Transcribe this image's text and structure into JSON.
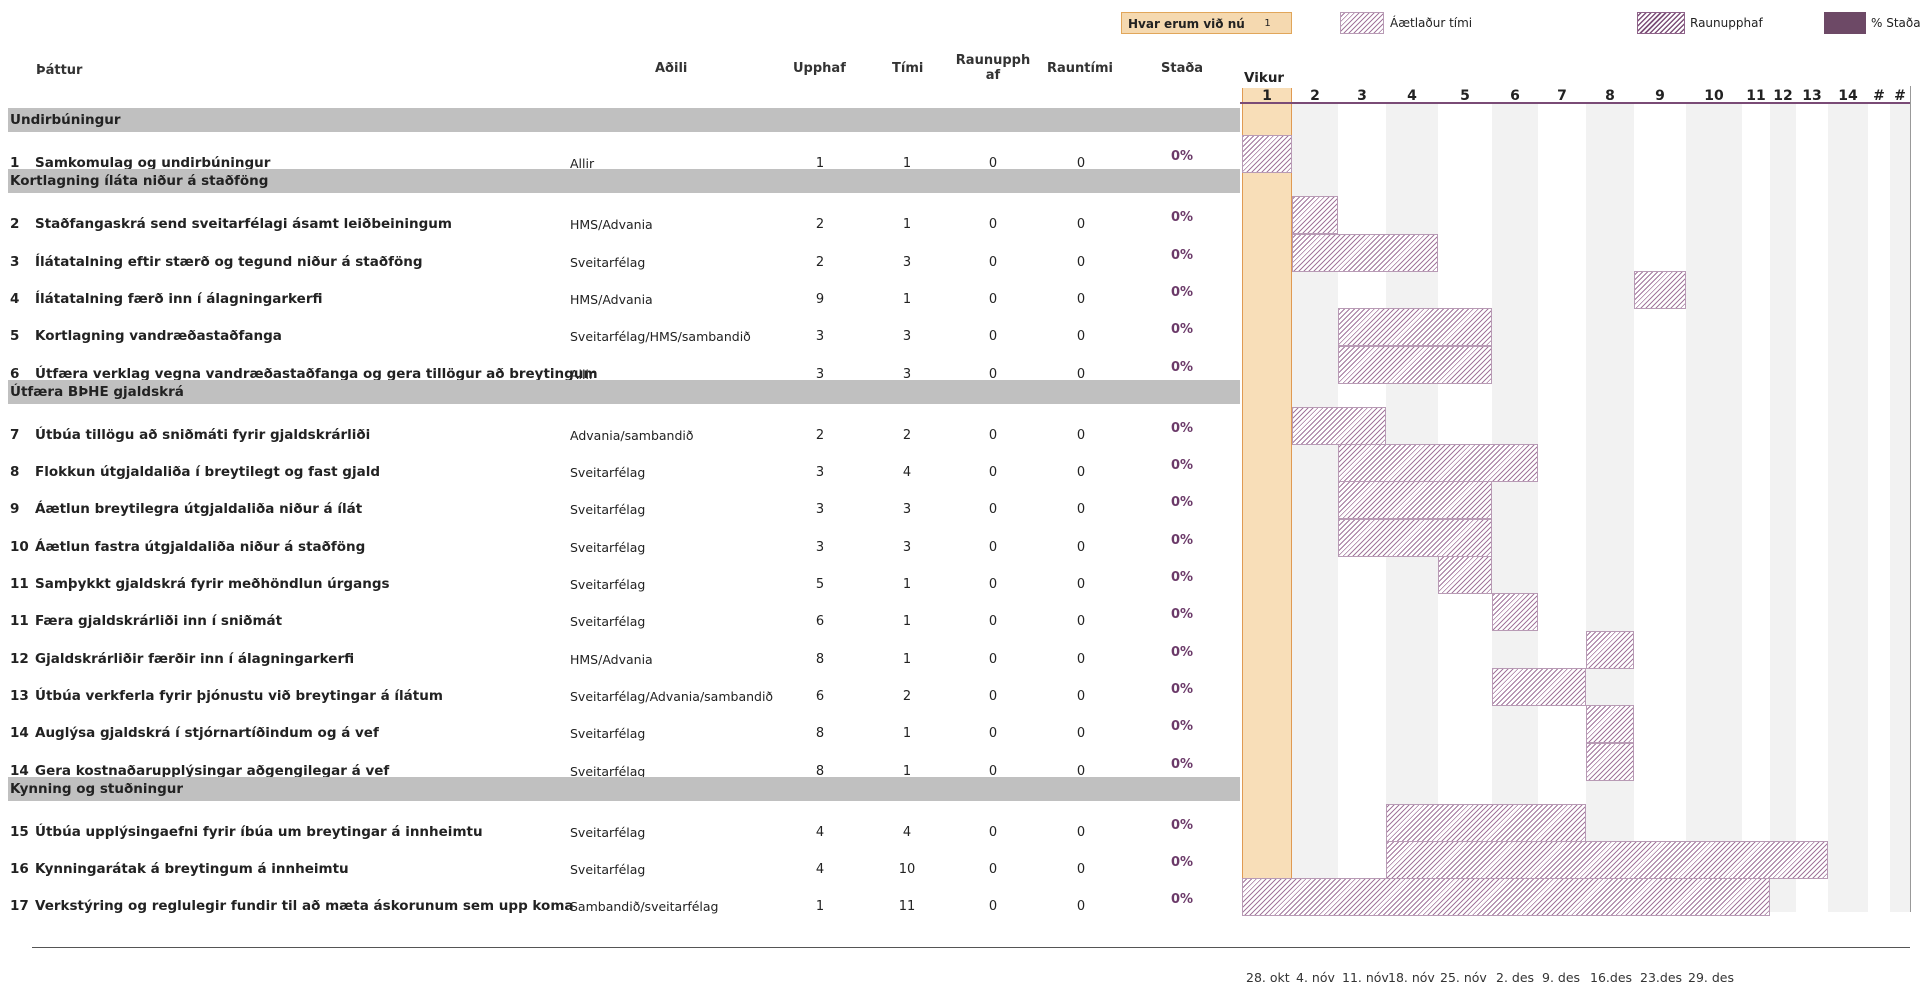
{
  "title": "",
  "where_are_we": {
    "label": "Hvar erum við núna",
    "value": "1"
  },
  "legend": {
    "planned": "Áætlaður tími",
    "actual": "Raunupphaf",
    "status": "% Staða"
  },
  "columns": {
    "task": "Þáttur",
    "owner": "Aðili",
    "start": "Upphaf",
    "duration": "Tími",
    "actual_start": "Raunupphaf",
    "actual_time": "Rauntími",
    "status": "Staða",
    "weeks": "Vikur"
  },
  "week_numbers": [
    "1",
    "2",
    "3",
    "4",
    "5",
    "6",
    "7",
    "8",
    "9",
    "10",
    "11",
    "12",
    "13",
    "14",
    "#",
    "#"
  ],
  "dates": [
    "28. okt",
    "4. nóv",
    "11. nóv",
    "18. nóv",
    "25. nóv",
    "2. des",
    "9. des",
    "16.des",
    "23.des",
    "29. des"
  ],
  "sections": [
    {
      "name": "Undirbúningur"
    },
    {
      "name": "Kortlagning íláta niður á staðföng"
    },
    {
      "name": "Útfæra BÞHE gjaldskrá"
    },
    {
      "name": "Kynning og stuðningur"
    }
  ],
  "tasks": [
    {
      "no": "1",
      "name": "Samkomulag og undirbúningur",
      "owner": "Allir",
      "start": 1,
      "duration": 1,
      "actual_start": "0",
      "actual_time": "0",
      "status": "0%"
    },
    {
      "no": "2",
      "name": "Staðfangaskrá send sveitarfélagi ásamt leiðbeiningum",
      "owner": "HMS/Advania",
      "start": 2,
      "duration": 1,
      "actual_start": "0",
      "actual_time": "0",
      "status": "0%"
    },
    {
      "no": "3",
      "name": "Ílátatalning eftir stærð og tegund niður á staðföng",
      "owner": "Sveitarfélag",
      "start": 2,
      "duration": 3,
      "actual_start": "0",
      "actual_time": "0",
      "status": "0%"
    },
    {
      "no": "4",
      "name": "Ílátatalning færð inn í álagningarkerfi",
      "owner": "HMS/Advania",
      "start": 9,
      "duration": 1,
      "actual_start": "0",
      "actual_time": "0",
      "status": "0%"
    },
    {
      "no": "5",
      "name": "Kortlagning vandræðastaðfanga",
      "owner": "Sveitarfélag/HMS/sambandið",
      "start": 3,
      "duration": 3,
      "actual_start": "0",
      "actual_time": "0",
      "status": "0%"
    },
    {
      "no": "6",
      "name": "Útfæra verklag vegna vandræðastaðfanga og gera tillögur að breytingum",
      "owner": "Allir",
      "start": 3,
      "duration": 3,
      "actual_start": "0",
      "actual_time": "0",
      "status": "0%"
    },
    {
      "no": "7",
      "name": "Útbúa tillögu að sniðmáti fyrir gjaldskrárliði",
      "owner": "Advania/sambandið",
      "start": 2,
      "duration": 2,
      "actual_start": "0",
      "actual_time": "0",
      "status": "0%"
    },
    {
      "no": "8",
      "name": "Flokkun útgjaldaliða í breytilegt og fast gjald",
      "owner": "Sveitarfélag",
      "start": 3,
      "duration": 4,
      "actual_start": "0",
      "actual_time": "0",
      "status": "0%"
    },
    {
      "no": "9",
      "name": "Áætlun breytilegra útgjaldaliða niður á ílát",
      "owner": "Sveitarfélag",
      "start": 3,
      "duration": 3,
      "actual_start": "0",
      "actual_time": "0",
      "status": "0%"
    },
    {
      "no": "10",
      "name": "Áætlun fastra útgjaldaliða niður á staðföng",
      "owner": "Sveitarfélag",
      "start": 3,
      "duration": 3,
      "actual_start": "0",
      "actual_time": "0",
      "status": "0%"
    },
    {
      "no": "11",
      "name": "Samþykkt gjaldskrá fyrir meðhöndlun úrgangs",
      "owner": "Sveitarfélag",
      "start": 5,
      "duration": 1,
      "actual_start": "0",
      "actual_time": "0",
      "status": "0%"
    },
    {
      "no": "11",
      "name": "Færa gjaldskrárliði inn í sniðmát",
      "owner": "Sveitarfélag",
      "start": 6,
      "duration": 1,
      "actual_start": "0",
      "actual_time": "0",
      "status": "0%"
    },
    {
      "no": "12",
      "name": "Gjaldskrárliðir færðir inn í álagningarkerfi",
      "owner": "HMS/Advania",
      "start": 8,
      "duration": 1,
      "actual_start": "0",
      "actual_time": "0",
      "status": "0%"
    },
    {
      "no": "13",
      "name": "Útbúa verkferla fyrir þjónustu við breytingar á ílátum",
      "owner": "Sveitarfélag/Advania/sambandið",
      "start": 6,
      "duration": 2,
      "actual_start": "0",
      "actual_time": "0",
      "status": "0%"
    },
    {
      "no": "14",
      "name": "Auglýsa gjaldskrá í stjórnartíðindum og á vef",
      "owner": "Sveitarfélag",
      "start": 8,
      "duration": 1,
      "actual_start": "0",
      "actual_time": "0",
      "status": "0%"
    },
    {
      "no": "14",
      "name": "Gera kostnaðarupplýsingar aðgengilegar á vef",
      "owner": "Sveitarfélag",
      "start": 8,
      "duration": 1,
      "actual_start": "0",
      "actual_time": "0",
      "status": "0%"
    },
    {
      "no": "15",
      "name": "Útbúa upplýsingaefni fyrir íbúa um breytingar á innheimtu",
      "owner": "Sveitarfélag",
      "start": 4,
      "duration": 4,
      "actual_start": "0",
      "actual_time": "0",
      "status": "0%"
    },
    {
      "no": "16",
      "name": "Kynningarátak á breytingum á innheimtu",
      "owner": "Sveitarfélag",
      "start": 4,
      "duration": 10,
      "actual_start": "0",
      "actual_time": "0",
      "status": "0%"
    },
    {
      "no": "17",
      "name": "Verkstýring og reglulegir fundir til að mæta áskorunum sem upp koma",
      "owner": "Sambandið/sveitarfélag",
      "start": 1,
      "duration": 11,
      "actual_start": "0",
      "actual_time": "0",
      "status": "0%"
    }
  ],
  "colors": {
    "accent": "#6b3a69",
    "current_week": "#f8deb8",
    "section_bg": "#c0c0c0",
    "hatch": "#a3779d"
  }
}
